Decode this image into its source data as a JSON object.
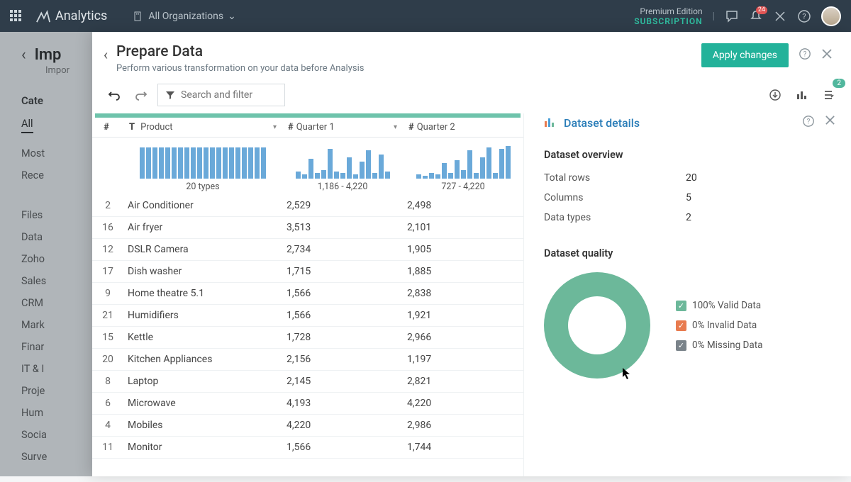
{
  "nav": {
    "brand": "Analytics",
    "org_label": "All Organizations",
    "premium_line1": "Premium Edition",
    "premium_line2": "SUBSCRIPTION",
    "notif_count": "24"
  },
  "bg": {
    "title": "Imp",
    "subtitle": "Impor",
    "categories_label": "Cate",
    "cats": [
      "All",
      "Most",
      "Rece",
      "Files",
      "Data",
      "Zoho",
      "Sales",
      "CRM",
      "Mark",
      "Finar",
      "IT & I",
      "Proje",
      "Hum",
      "Socia",
      "Surve"
    ]
  },
  "modal": {
    "title": "Prepare Data",
    "subtitle": "Perform various transformation on your data before Analysis",
    "apply": "Apply changes",
    "search_placeholder": "Search and filter",
    "rule_badge": "2"
  },
  "table": {
    "columns": {
      "idx": "#",
      "type_icon": "T",
      "product": "Product",
      "q1": "Quarter 1",
      "q2": "Quarter 2",
      "num_icon": "#"
    },
    "spark": {
      "product_label": "20 types",
      "q1_label": "1,186 - 4,220",
      "q2_label": "727 - 4,220"
    },
    "rows": [
      {
        "idx": "2",
        "product": "Air Conditioner",
        "q1": "2,529",
        "q2": "2,498"
      },
      {
        "idx": "16",
        "product": "Air fryer",
        "q1": "3,513",
        "q2": "2,101"
      },
      {
        "idx": "12",
        "product": "DSLR Camera",
        "q1": "2,734",
        "q2": "1,905"
      },
      {
        "idx": "17",
        "product": "Dish washer",
        "q1": "1,715",
        "q2": "1,885"
      },
      {
        "idx": "9",
        "product": "Home theatre 5.1",
        "q1": "1,566",
        "q2": "2,838"
      },
      {
        "idx": "21",
        "product": "Humidifiers",
        "q1": "1,566",
        "q2": "1,921"
      },
      {
        "idx": "15",
        "product": "Kettle",
        "q1": "1,728",
        "q2": "2,966"
      },
      {
        "idx": "20",
        "product": "Kitchen Appliances",
        "q1": "2,156",
        "q2": "1,197"
      },
      {
        "idx": "8",
        "product": "Laptop",
        "q1": "2,145",
        "q2": "2,821"
      },
      {
        "idx": "6",
        "product": "Microwave",
        "q1": "4,193",
        "q2": "4,220"
      },
      {
        "idx": "4",
        "product": "Mobiles",
        "q1": "4,220",
        "q2": "2,986"
      },
      {
        "idx": "11",
        "product": "Monitor",
        "q1": "1,566",
        "q2": "1,744"
      }
    ]
  },
  "details": {
    "title": "Dataset details",
    "overview_label": "Dataset overview",
    "total_rows_k": "Total rows",
    "total_rows_v": "20",
    "columns_k": "Columns",
    "columns_v": "5",
    "datatypes_k": "Data types",
    "datatypes_v": "2",
    "quality_label": "Dataset quality",
    "legend": {
      "valid": "100% Valid Data",
      "invalid": "0% Invalid Data",
      "missing": "0% Missing Data"
    }
  },
  "chart_data": {
    "type": "pie",
    "title": "Dataset quality",
    "series": [
      {
        "name": "Valid Data",
        "value": 100,
        "color": "#6cb89a"
      },
      {
        "name": "Invalid Data",
        "value": 0,
        "color": "#e87b4f"
      },
      {
        "name": "Missing Data",
        "value": 0,
        "color": "#7a838a"
      }
    ]
  }
}
